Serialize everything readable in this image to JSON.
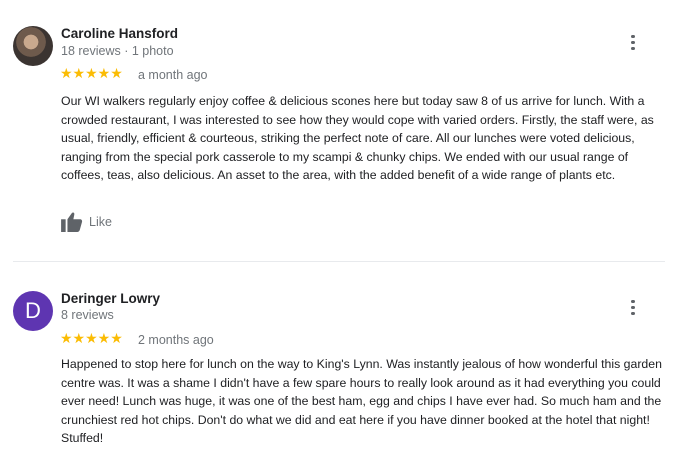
{
  "reviews": [
    {
      "name": "Caroline Hansford",
      "meta": "18 reviews · 1 photo",
      "stars": "★★★★★",
      "ago": "a month ago",
      "text": "Our WI walkers regularly enjoy coffee & delicious scones here but today saw 8 of us arrive for lunch. With a crowded restaurant, I was interested to see how they would cope with varied orders. Firstly, the staff were, as usual, friendly, efficient & courteous, striking the perfect note of care. All our lunches were voted delicious, ranging from the special pork casserole to my scampi & chunky chips. We ended with our usual range of coffees, teas, also delicious. An asset to the area, with the added benefit of a wide range of plants etc.",
      "like_label": "Like"
    },
    {
      "name": "Deringer Lowry",
      "meta": "8 reviews",
      "avatar_letter": "D",
      "stars": "★★★★★",
      "ago": "2 months ago",
      "text": "Happened to stop here for lunch on the way to King's Lynn. Was instantly jealous of how wonderful this garden centre was. It was a shame I didn't have a few spare hours to really look around as it had everything you could ever need! Lunch was huge, it was one of the best ham, egg and chips I have ever had. So much ham and the crunchiest red hot chips.  Don't  do what we did and eat here if you have dinner booked at the hotel that night! Stuffed!"
    }
  ],
  "colors": {
    "star": "#fbbc04",
    "avatar_d": "#5e35b1",
    "meta": "#70757a"
  },
  "icons": {
    "more": "more-vert-icon",
    "like": "thumbs-up-icon"
  }
}
